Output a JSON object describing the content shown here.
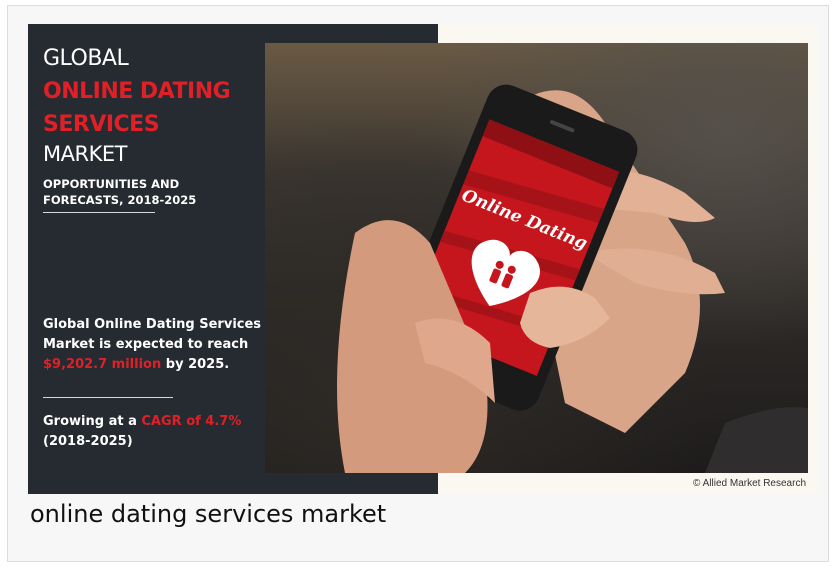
{
  "infographic": {
    "heading_line1": "GLOBAL",
    "heading_red_line1": "ONLINE DATING",
    "heading_red_line2": "SERVICES",
    "heading_line4": "MARKET",
    "subheading": "OPPORTUNITIES AND FORECASTS, 2018-2025",
    "stat_text_before": "Global Online Dating Services Market is expected to reach ",
    "stat_value": "$9,202.7 million",
    "stat_text_after": " by 2025.",
    "growth_text_before": "Growing at a ",
    "growth_value": "CAGR of 4.7%",
    "growth_period": "(2018-2025)",
    "phone_app_title": "Online Dating",
    "credit": "© Allied Market Research"
  },
  "caption": "online dating services market",
  "colors": {
    "accent_red": "#e11f27",
    "panel_dark": "#262b31"
  }
}
